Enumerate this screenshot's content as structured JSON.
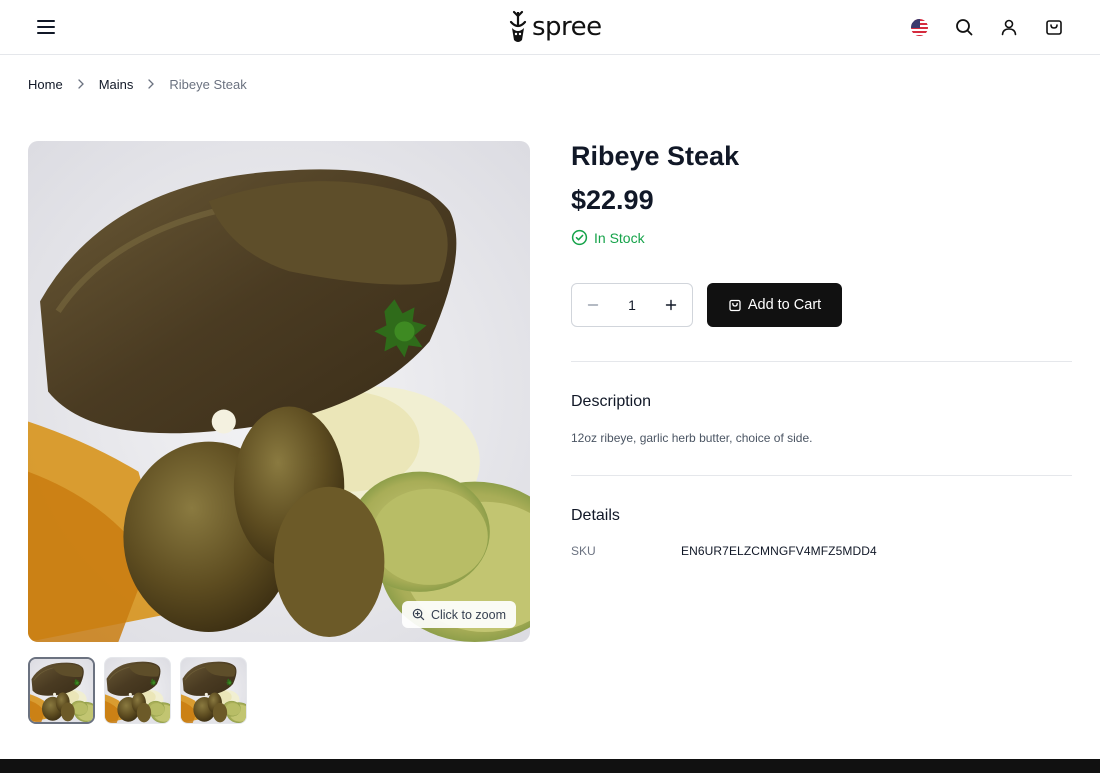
{
  "header": {
    "logo_text": "spree",
    "icons": [
      "menu-icon",
      "us-flag-icon",
      "search-icon",
      "user-icon",
      "cart-icon"
    ]
  },
  "breadcrumb": {
    "items": [
      "Home",
      "Mains",
      "Ribeye Steak"
    ]
  },
  "gallery": {
    "zoom_label": "Click to zoom",
    "thumbnail_count": 3,
    "selected_thumbnail": 1
  },
  "product": {
    "name": "Ribeye Steak",
    "price": "$22.99",
    "stock_status": "In Stock",
    "quantity": "1",
    "add_to_cart_label": "Add to Cart",
    "description_heading": "Description",
    "description": "12oz ribeye, garlic herb butter, choice of side.",
    "details_heading": "Details",
    "sku_label": "SKU",
    "sku_value": "EN6UR7ELZCMNGFV4MFZ5MDD4"
  },
  "colors": {
    "accent": "#111111",
    "in_stock": "#16a34a",
    "border": "#e5e7eb"
  }
}
